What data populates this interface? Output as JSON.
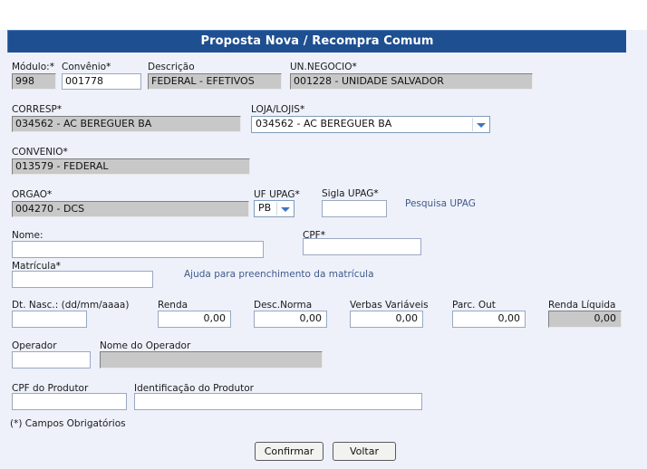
{
  "header": {
    "title": "Proposta Nova / Recompra Comum"
  },
  "form": {
    "modulo": {
      "label": "Módulo:",
      "required": true,
      "value": "998",
      "readonly": true
    },
    "convenio_num": {
      "label": "Convênio",
      "required": true,
      "value": "001778",
      "readonly": false
    },
    "descricao": {
      "label": "Descrição",
      "required": false,
      "value": "FEDERAL - EFETIVOS",
      "readonly": true
    },
    "un_negocio": {
      "label": "UN.NEGOCIO",
      "required": true,
      "value": "001228 - UNIDADE SALVADOR",
      "readonly": true
    },
    "corresp": {
      "label": "CORRESP",
      "required": true,
      "value": "034562 - AC BEREGUER BA",
      "readonly": true
    },
    "loja_lojis": {
      "label": "LOJA/LOJIS",
      "required": true,
      "selected": "034562 - AC BEREGUER BA",
      "options": [
        "034562 - AC BEREGUER BA"
      ]
    },
    "convenio": {
      "label": "CONVENIO",
      "required": true,
      "value": "013579 - FEDERAL",
      "readonly": true
    },
    "orgao": {
      "label": "ORGAO",
      "required": true,
      "value": "004270 - DCS",
      "readonly": true
    },
    "uf_upag": {
      "label": "UF UPAG",
      "required": true,
      "selected": "PB",
      "options": [
        "PB"
      ]
    },
    "sigla_upag": {
      "label": "Sigla UPAG",
      "required": true,
      "value": "",
      "placeholder": ""
    },
    "pesquisa_upag_link": "Pesquisa UPAG",
    "nome": {
      "label": "Nome:",
      "required": false,
      "value": "",
      "placeholder": ""
    },
    "cpf": {
      "label": "CPF",
      "required": true,
      "value": "",
      "placeholder": ""
    },
    "matricula": {
      "label": "Matrícula",
      "required": true,
      "value": "",
      "placeholder": ""
    },
    "matricula_help": "Ajuda para preenchimento da matrícula",
    "dt_nasc": {
      "label": "Dt. Nasc.: (dd/mm/aaaa)",
      "required": false,
      "value": "",
      "placeholder": ""
    },
    "renda": {
      "label": "Renda",
      "required": false,
      "value": "0,00"
    },
    "desc_norma": {
      "label": "Desc.Norma",
      "required": false,
      "value": "0,00"
    },
    "verbas_variaveis": {
      "label": "Verbas Variáveis",
      "required": false,
      "value": "0,00"
    },
    "parc_out": {
      "label": "Parc. Out",
      "required": false,
      "value": "0,00"
    },
    "renda_liquida": {
      "label": "Renda Líquida",
      "required": false,
      "value": "0,00",
      "readonly": true
    },
    "operador": {
      "label": "Operador",
      "required": false,
      "value": "",
      "placeholder": ""
    },
    "nome_operador": {
      "label": "Nome do Operador",
      "required": false,
      "value": "",
      "readonly": true
    },
    "cpf_produtor": {
      "label": "CPF do Produtor",
      "required": false,
      "value": "",
      "placeholder": ""
    },
    "identificacao_produtor": {
      "label": "Identificação do Produtor",
      "required": false,
      "value": "",
      "placeholder": ""
    }
  },
  "footer": {
    "required_note": "(*) Campos Obrigatórios",
    "confirm_label": "Confirmar",
    "back_label": "Voltar"
  },
  "colors": {
    "title_bar": "#1e4f91",
    "page_background": "#eef1fa",
    "readonly_field": "#c8c8c8",
    "link": "#3f5a8a",
    "field_border": "#9aa8c2"
  }
}
